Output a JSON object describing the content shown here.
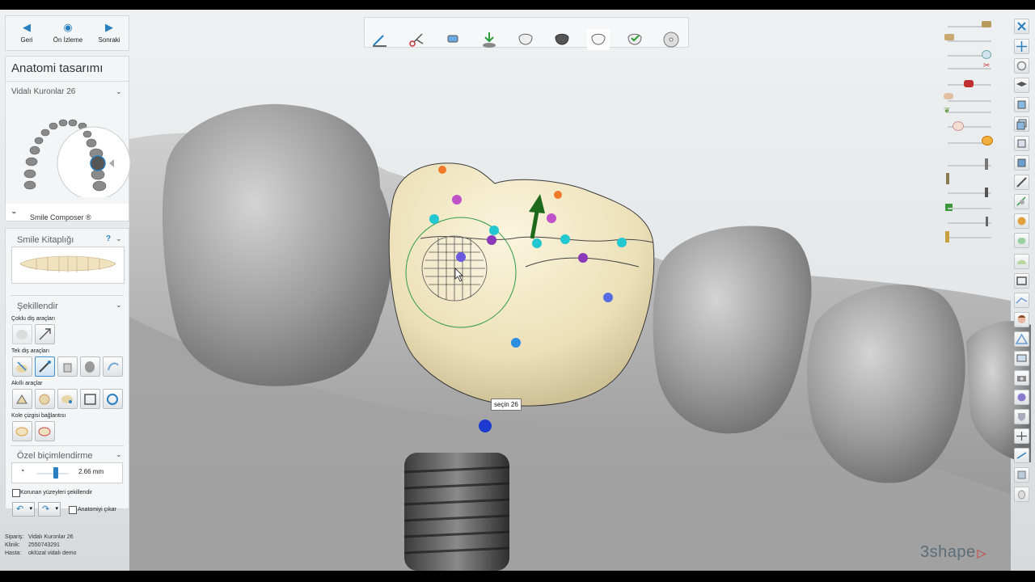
{
  "nav": {
    "back": "Geri",
    "preview": "Ön İzleme",
    "next": "Sonraki"
  },
  "panel": {
    "title": "Anatomi tasarımı",
    "subtitle": "Vidalı Kuronlar 26",
    "smile_composer": "Smile Composer ®"
  },
  "library": {
    "title": "Smile Kitaplığı",
    "help": "?"
  },
  "shape": {
    "title": "Şekillendir",
    "multi_tools": "Çoklu diş araçları",
    "single_tools": "Tek diş araçları",
    "smart_tools": "Akıllı araçlar",
    "margin_link": "Kole çizgisi bağlantısı"
  },
  "custom": {
    "title": "Özel biçimlendirme",
    "value": "2.66 mm",
    "value_fraction": 0.42,
    "protected": "Korunan yüzeyleri şekillendir",
    "anatomy_remove": "Anatomiyi çıkar"
  },
  "tooltip": "seçin 26",
  "info": {
    "order_label": "Sipariş:",
    "order_value": "Vidalı Kuronlar 26",
    "clinic_label": "Klinik:",
    "clinic_value": "2550743291",
    "patient_label": "Hasta:",
    "patient_value": "oklüzal vidalı demo"
  },
  "brand": "3shape",
  "colors": {
    "accent": "#2a7fc0",
    "crown": "#ece0b8",
    "gum": "#a9a9a9",
    "arrow": "#1d6a1d"
  }
}
